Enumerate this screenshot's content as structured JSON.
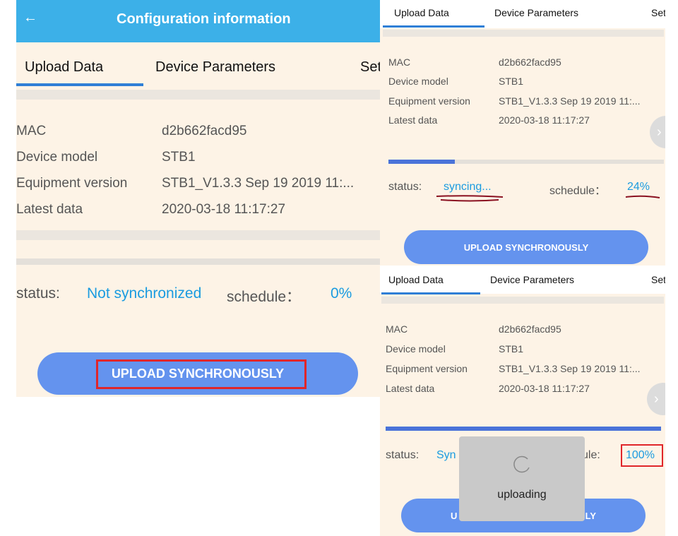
{
  "left_screen": {
    "header": {
      "back_icon": "back-arrow-icon",
      "title": "Configuration information",
      "bg": "#3cb0e8"
    },
    "tabs": [
      "Upload Data",
      "Device Parameters",
      "Set"
    ],
    "rows": [
      {
        "label": "MAC",
        "value": "d2b662facd95"
      },
      {
        "label": "Device model",
        "value": "STB1"
      },
      {
        "label": "Equipment version",
        "value": "STB1_V1.3.3 Sep 19 2019 11:..."
      },
      {
        "label": "Latest data",
        "value": "2020-03-18 11:17:27"
      }
    ],
    "status_label": "status:",
    "status_value": "Not synchronized",
    "schedule_label": "schedule：",
    "schedule_value": "0%",
    "progress": 0,
    "button": "UPLOAD SYNCHRONOUSLY"
  },
  "top_right_screen": {
    "tabs": [
      "Upload Data",
      "Device Parameters",
      "Set"
    ],
    "rows": [
      {
        "label": "MAC",
        "value": "d2b662facd95"
      },
      {
        "label": "Device model",
        "value": "STB1"
      },
      {
        "label": "Equipment version",
        "value": "STB1_V1.3.3 Sep 19 2019 11:..."
      },
      {
        "label": "Latest data",
        "value": "2020-03-18 11:17:27"
      }
    ],
    "status_label": "status:",
    "status_value": "syncing...",
    "schedule_label": "schedule：",
    "schedule_value": "24%",
    "progress": 0.24,
    "button": "UPLOAD SYNCHRONOUSLY"
  },
  "bottom_right_screen": {
    "tabs": [
      "Upload Data",
      "Device Parameters",
      "Set"
    ],
    "rows": [
      {
        "label": "MAC",
        "value": "d2b662facd95"
      },
      {
        "label": "Device model",
        "value": "STB1"
      },
      {
        "label": "Equipment version",
        "value": "STB1_V1.3.3 Sep 19 2019 11:..."
      },
      {
        "label": "Latest data",
        "value": "2020-03-18 11:17:27"
      }
    ],
    "status_label": "status:",
    "status_value_visible": "Syn",
    "schedule_label_visible": "ule:",
    "schedule_value": "100%",
    "progress": 1.0,
    "button_left_visible": "U",
    "button_right_visible": "LY",
    "dialog": {
      "icon": "spinner-icon",
      "text": "uploading"
    }
  },
  "colors": {
    "accent_blue": "#1a9be0",
    "progress_fill": "#4a73d9",
    "button_blue": "#6493ee",
    "panel_bg": "#fdf3e6",
    "highlight_red": "#e0262a",
    "underline_dark_red": "#8a1020"
  }
}
